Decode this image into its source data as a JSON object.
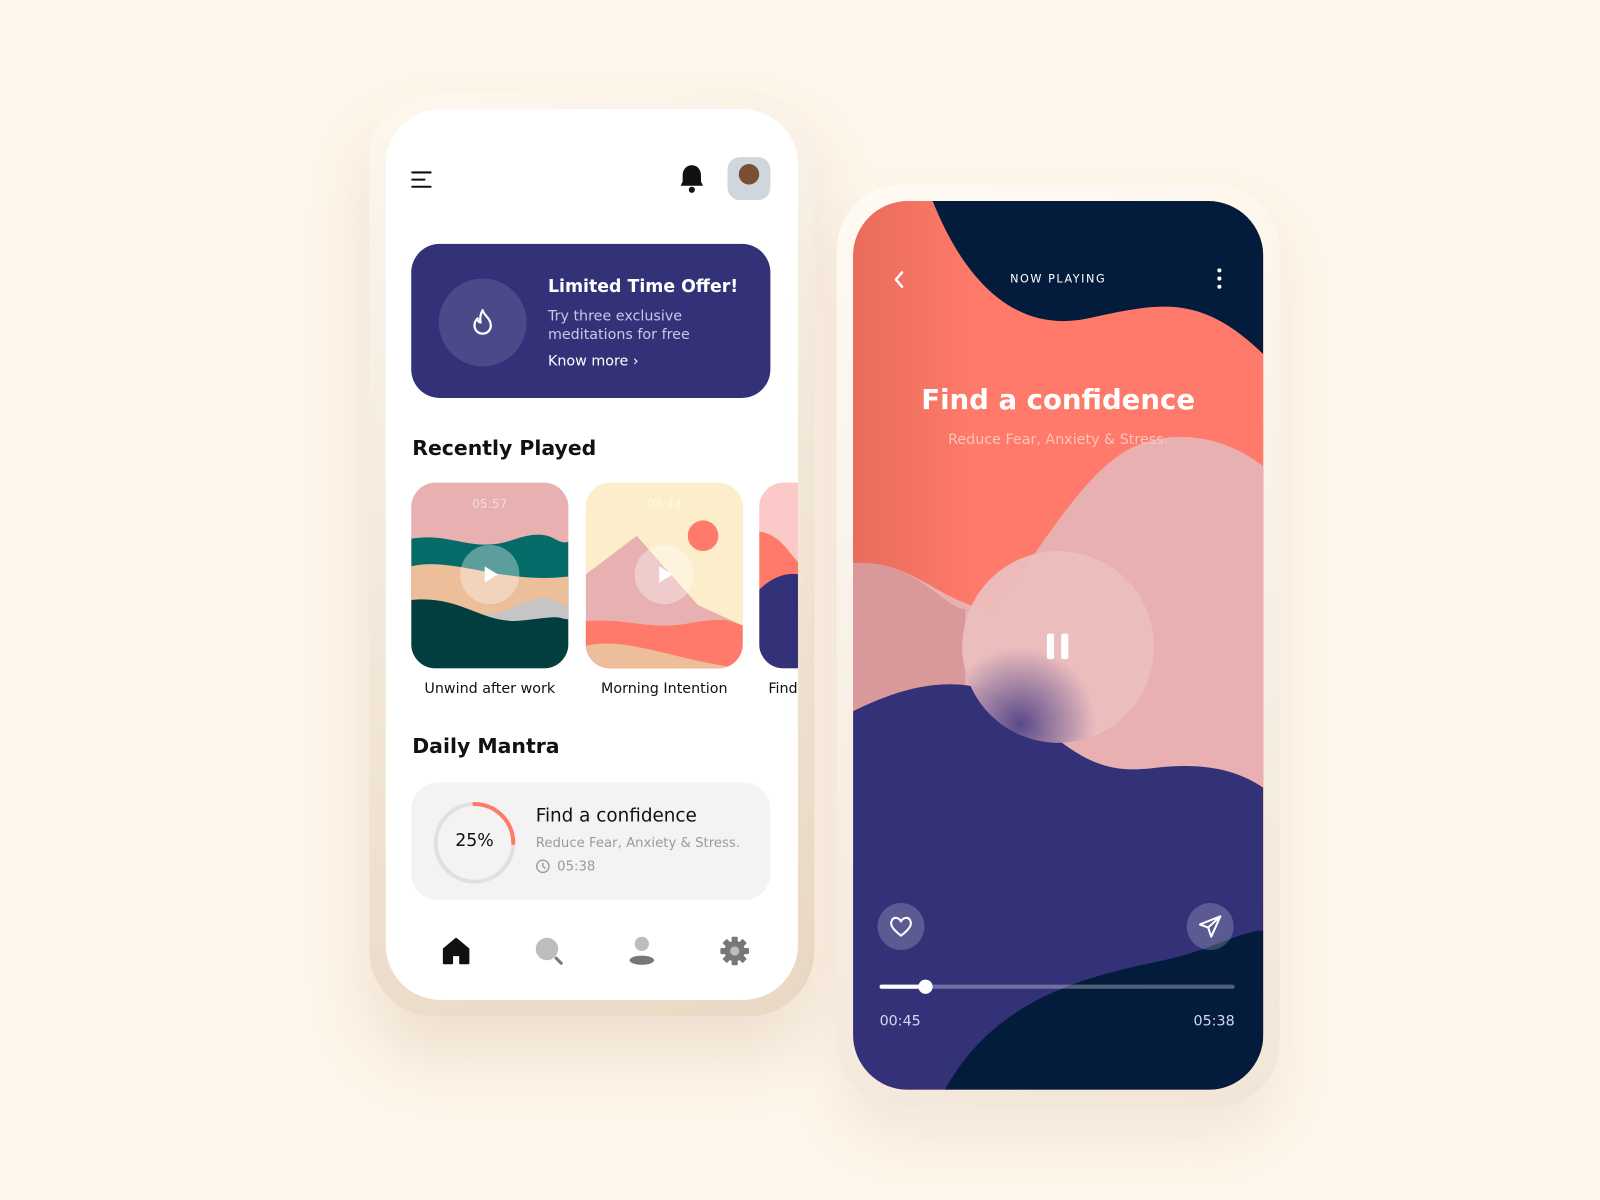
{
  "home": {
    "offer": {
      "title": "Limited Time Offer!",
      "subtitle_line1": "Try three exclusive",
      "subtitle_line2": "meditations for free",
      "link": "Know more ›",
      "icon": "flame-icon"
    },
    "recently_played_title": "Recently Played",
    "recently_played": [
      {
        "title": "Unwind after work",
        "duration": "05:57"
      },
      {
        "title": "Morning Intention",
        "duration": "03:44"
      },
      {
        "title": "Find",
        "duration": ""
      }
    ],
    "daily_mantra_title": "Daily Mantra",
    "mantra": {
      "title": "Find a confidence",
      "subtitle": "Reduce Fear, Anxiety & Stress.",
      "duration": "05:38",
      "progress_label": "25%",
      "progress": 0.25
    },
    "nav": [
      "home-icon",
      "search-icon",
      "profile-icon",
      "settings-icon"
    ]
  },
  "player": {
    "header": "NOW PLAYING",
    "title": "Find a confidence",
    "subtitle": "Reduce Fear, Anxiety & Stress.",
    "elapsed": "00:45",
    "total": "05:38",
    "progress": 0.13
  },
  "colors": {
    "accent": "#ff7a6a",
    "navy": "#041c3c",
    "indigo": "#333178",
    "pink": "#e8b0b0"
  }
}
